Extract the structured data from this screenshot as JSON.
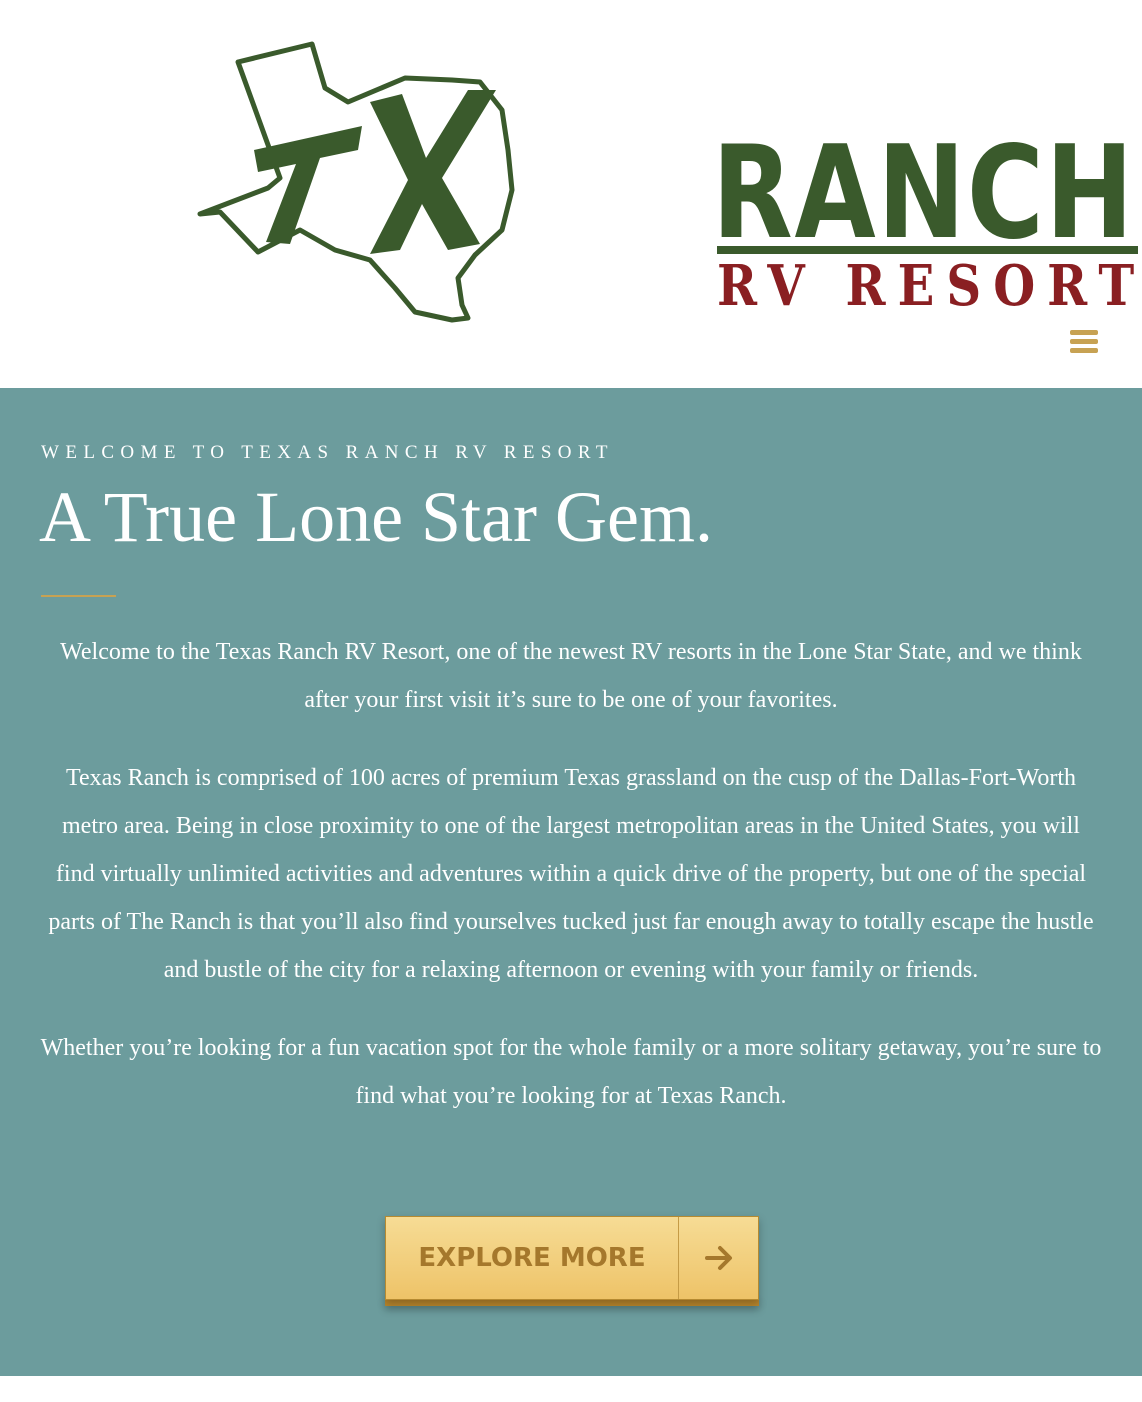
{
  "header": {
    "logo": {
      "word_ranch": "RANCH",
      "word_rv_resort": "RV RESORT",
      "emblem_letters": "TX",
      "emblem": "texas-map-emblem"
    },
    "menu_icon": "hamburger-menu-icon"
  },
  "hero": {
    "eyebrow": "WELCOME TO TEXAS RANCH RV RESORT",
    "headline": "A True Lone Star Gem.",
    "paragraphs": [
      "Welcome to the Texas Ranch RV Resort, one of the newest RV resorts in the Lone Star State, and we think after your first visit it’s sure to be one of your favorites.",
      "Texas Ranch is comprised of 100 acres of premium Texas grassland on the cusp of the Dallas-Fort-Worth metro area. Being in close proximity to one of the largest metropolitan areas in the United States, you will find virtually unlimited activities and adventures within a quick drive of the property, but one of the special parts of The Ranch is that you’ll also find yourselves tucked just far enough away to totally escape the hustle and bustle of the city for a relaxing afternoon or evening with your family or friends.",
      "Whether you’re looking for a fun vacation spot for the whole family or a more solitary getaway, you’re sure to find what you’re looking for at Texas Ranch."
    ],
    "cta": {
      "label": "EXPLORE MORE",
      "icon": "arrow-right-icon"
    }
  },
  "colors": {
    "logo_green": "#3a5a2c",
    "logo_red": "#8a1f22",
    "hero_background": "#6c9c9d",
    "accent_gold": "#c7a253",
    "button_text": "#a5782c"
  }
}
